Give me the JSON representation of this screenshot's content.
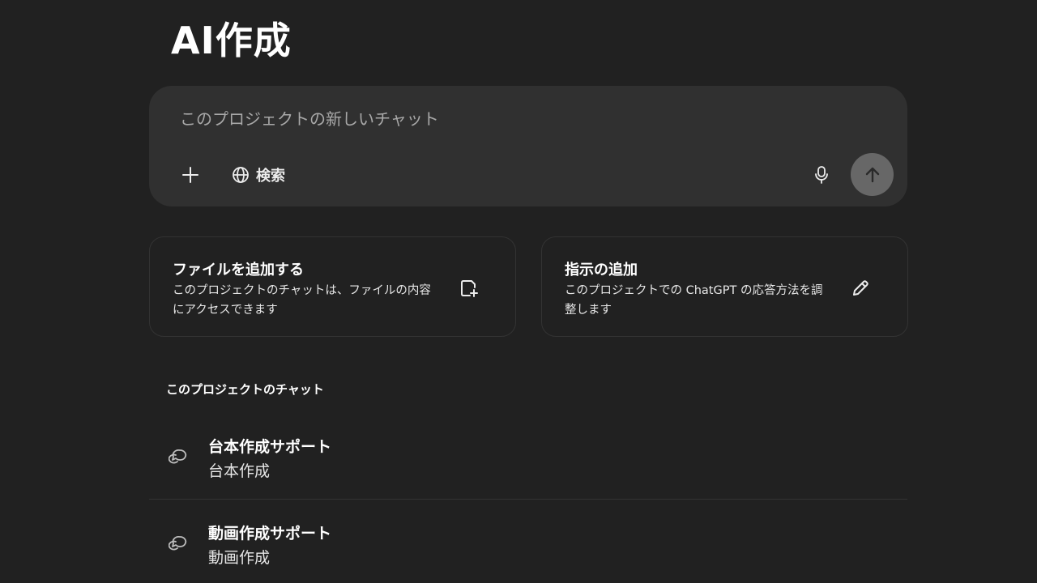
{
  "project": {
    "title": "AI作成"
  },
  "composer": {
    "placeholder": "このプロジェクトの新しいチャット",
    "search_label": "検索",
    "icons": {
      "plus": "plus-icon",
      "search": "globe-icon",
      "mic": "microphone-icon",
      "send": "arrow-up-icon"
    }
  },
  "cards": [
    {
      "title": "ファイルを追加する",
      "description": "このプロジェクトのチャットは、ファイルの内容にアクセスできます",
      "icon": "file-add-icon"
    },
    {
      "title": "指示の追加",
      "description": "このプロジェクトでの ChatGPT の応答方法を調整します",
      "icon": "pencil-icon"
    }
  ],
  "chats_section": {
    "heading": "このプロジェクトのチャット",
    "items": [
      {
        "title": "台本作成サポート",
        "subtitle": "台本作成",
        "icon": "chat-bubbles-icon"
      },
      {
        "title": "動画作成サポート",
        "subtitle": "動画作成",
        "icon": "chat-bubbles-icon"
      }
    ]
  },
  "colors": {
    "background": "#212121",
    "composer": "#303030",
    "send_button": "#676767",
    "card_border": "#333333"
  }
}
